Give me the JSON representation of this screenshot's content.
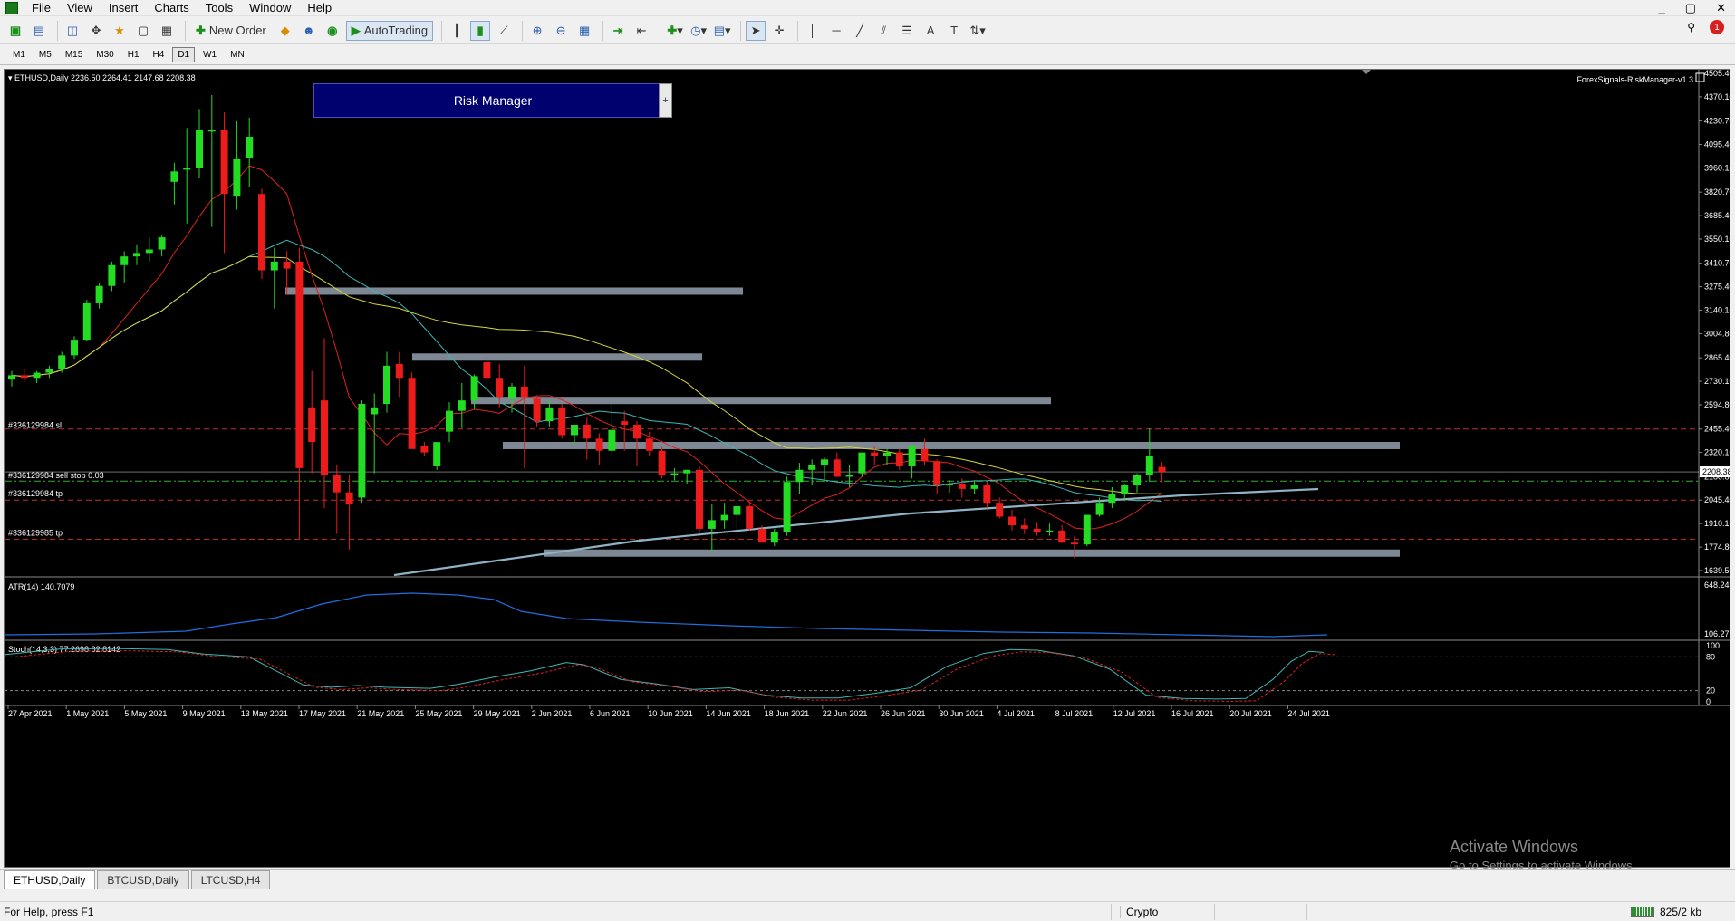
{
  "menu": {
    "items": [
      "File",
      "View",
      "Insert",
      "Charts",
      "Tools",
      "Window",
      "Help"
    ],
    "window_controls": [
      "_",
      "▢",
      "✕"
    ]
  },
  "toolbar": {
    "new_order_label": "New Order",
    "autotrading_label": "AutoTrading",
    "notification_count": "1"
  },
  "timeframes": [
    "M1",
    "M5",
    "M15",
    "M30",
    "H1",
    "H4",
    "D1",
    "W1",
    "MN"
  ],
  "active_timeframe": "D1",
  "chart": {
    "header": "ETHUSD,Daily  2236.50 2264.41 2147.68 2208.38",
    "indicator_name": "ForexSignals-RiskManager-v1.3",
    "risk_manager_label": "Risk Manager",
    "risk_expand_label": "+",
    "order_labels": [
      "#336129984 sl",
      "#336129984 sell stop 0.03",
      "#336129984 tp",
      "#336129985 tp"
    ],
    "current_price": "2208.38",
    "price_axis": [
      "4505.40",
      "4370.10",
      "4230.70",
      "4095.40",
      "3960.10",
      "3820.70",
      "3685.40",
      "3550.10",
      "3410.70",
      "3275.40",
      "3140.10",
      "3004.80",
      "2865.40",
      "2730.10",
      "2594.80",
      "2455.40",
      "2320.10",
      "2180.80",
      "2045.40",
      "1910.10",
      "1774.80",
      "1639.50"
    ],
    "date_axis": [
      "27 Apr 2021",
      "1 May 2021",
      "5 May 2021",
      "9 May 2021",
      "13 May 2021",
      "17 May 2021",
      "21 May 2021",
      "25 May 2021",
      "29 May 2021",
      "2 Jun 2021",
      "6 Jun 2021",
      "10 Jun 2021",
      "14 Jun 2021",
      "18 Jun 2021",
      "22 Jun 2021",
      "26 Jun 2021",
      "30 Jun 2021",
      "4 Jul 2021",
      "8 Jul 2021",
      "12 Jul 2021",
      "16 Jul 2021",
      "20 Jul 2021",
      "24 Jul 2021"
    ],
    "atr_label": "ATR(14) 140.7079",
    "atr_axis": [
      "648.2496",
      "106.2717"
    ],
    "stoch_label": "Stoch(14,3,3) 77.2698 82.8142",
    "stoch_axis": [
      "100",
      "80",
      "20",
      "0"
    ]
  },
  "chart_data": {
    "type": "candlestick",
    "symbol": "ETHUSD",
    "timeframe": "Daily",
    "ylim": [
      1639.5,
      4505.4
    ],
    "candles": [
      [
        2740,
        2790,
        2700,
        2765
      ],
      [
        2765,
        2800,
        2730,
        2750
      ],
      [
        2750,
        2790,
        2720,
        2780
      ],
      [
        2780,
        2820,
        2750,
        2800
      ],
      [
        2800,
        2900,
        2780,
        2880
      ],
      [
        2880,
        2990,
        2860,
        2970
      ],
      [
        2970,
        3200,
        2960,
        3180
      ],
      [
        3180,
        3300,
        3150,
        3280
      ],
      [
        3280,
        3420,
        3250,
        3400
      ],
      [
        3400,
        3480,
        3300,
        3450
      ],
      [
        3450,
        3520,
        3400,
        3470
      ],
      [
        3470,
        3560,
        3420,
        3490
      ],
      [
        3490,
        3570,
        3450,
        3560
      ],
      [
        3880,
        3990,
        3750,
        3940
      ],
      [
        3950,
        4190,
        3640,
        3960
      ],
      [
        3960,
        4300,
        3900,
        4180
      ],
      [
        4170,
        4380,
        3620,
        4180
      ],
      [
        4180,
        4280,
        3470,
        3810
      ],
      [
        3800,
        4230,
        3720,
        4010
      ],
      [
        4020,
        4250,
        3850,
        4140
      ],
      [
        3810,
        3840,
        3320,
        3370
      ],
      [
        3370,
        3500,
        3150,
        3420
      ],
      [
        3420,
        3480,
        3230,
        3380
      ],
      [
        3420,
        3500,
        1820,
        2230
      ],
      [
        2580,
        2790,
        2200,
        2380
      ],
      [
        2620,
        2980,
        2000,
        2190
      ],
      [
        2190,
        2250,
        1850,
        2090
      ],
      [
        2090,
        2190,
        1760,
        2020
      ],
      [
        2060,
        2620,
        2030,
        2600
      ],
      [
        2540,
        2660,
        2200,
        2580
      ],
      [
        2600,
        2900,
        2550,
        2820
      ],
      [
        2830,
        2900,
        2640,
        2750
      ],
      [
        2750,
        2780,
        2420,
        2340
      ],
      [
        2360,
        2380,
        2300,
        2320
      ],
      [
        2240,
        2340,
        2220,
        2380
      ],
      [
        2440,
        2610,
        2380,
        2560
      ],
      [
        2560,
        2720,
        2460,
        2620
      ],
      [
        2620,
        2770,
        2570,
        2760
      ],
      [
        2840,
        2880,
        2650,
        2750
      ],
      [
        2750,
        2830,
        2580,
        2640
      ],
      [
        2630,
        2720,
        2550,
        2700
      ],
      [
        2700,
        2820,
        2230,
        2640
      ],
      [
        2630,
        2650,
        2470,
        2500
      ],
      [
        2500,
        2620,
        2470,
        2580
      ],
      [
        2580,
        2600,
        2400,
        2420
      ],
      [
        2420,
        2470,
        2360,
        2480
      ],
      [
        2480,
        2520,
        2280,
        2400
      ],
      [
        2400,
        2430,
        2250,
        2330
      ],
      [
        2330,
        2600,
        2300,
        2450
      ],
      [
        2500,
        2560,
        2330,
        2480
      ],
      [
        2480,
        2500,
        2240,
        2400
      ],
      [
        2400,
        2440,
        2300,
        2330
      ],
      [
        2330,
        2350,
        2170,
        2190
      ],
      [
        2190,
        2230,
        2160,
        2200
      ],
      [
        2200,
        2220,
        2140,
        2220
      ],
      [
        2220,
        2240,
        1850,
        1880
      ],
      [
        1880,
        2020,
        1750,
        1930
      ],
      [
        1930,
        2030,
        1880,
        1960
      ],
      [
        1960,
        2030,
        1860,
        2010
      ],
      [
        2010,
        2040,
        1870,
        1880
      ],
      [
        1880,
        1900,
        1800,
        1800
      ],
      [
        1800,
        1880,
        1780,
        1860
      ],
      [
        1860,
        2180,
        1840,
        2150
      ],
      [
        2150,
        2260,
        2080,
        2220
      ],
      [
        2220,
        2280,
        2130,
        2250
      ],
      [
        2250,
        2290,
        2150,
        2280
      ],
      [
        2280,
        2320,
        2180,
        2180
      ],
      [
        2180,
        2250,
        2120,
        2190
      ],
      [
        2200,
        2310,
        2180,
        2320
      ],
      [
        2320,
        2360,
        2250,
        2300
      ],
      [
        2300,
        2340,
        2250,
        2320
      ],
      [
        2320,
        2340,
        2220,
        2240
      ],
      [
        2240,
        2280,
        2170,
        2360
      ],
      [
        2340,
        2400,
        2250,
        2270
      ],
      [
        2270,
        2280,
        2080,
        2130
      ],
      [
        2130,
        2160,
        2090,
        2140
      ],
      [
        2140,
        2170,
        2060,
        2110
      ],
      [
        2110,
        2160,
        2080,
        2130
      ],
      [
        2130,
        2150,
        2000,
        2030
      ],
      [
        2030,
        2060,
        1940,
        1950
      ],
      [
        1950,
        1990,
        1870,
        1900
      ],
      [
        1900,
        1940,
        1850,
        1880
      ],
      [
        1880,
        1920,
        1840,
        1860
      ],
      [
        1860,
        1910,
        1840,
        1870
      ],
      [
        1870,
        1900,
        1800,
        1800
      ],
      [
        1800,
        1840,
        1710,
        1790
      ],
      [
        1790,
        1960,
        1780,
        1960
      ],
      [
        1960,
        2060,
        1950,
        2030
      ],
      [
        2030,
        2120,
        2000,
        2080
      ],
      [
        2080,
        2140,
        2040,
        2130
      ],
      [
        2130,
        2200,
        2090,
        2190
      ],
      [
        2190,
        2460,
        2150,
        2300
      ],
      [
        2236.5,
        2264.41,
        2147.68,
        2208.38
      ]
    ],
    "levels": {
      "order_sl": 2455.4,
      "sell_stop": 2155,
      "tp1": 2045.4,
      "tp2": 1820,
      "current": 2208.38
    },
    "atr": 140.7079,
    "stoch": [
      77.2698,
      82.8142
    ]
  }
}
